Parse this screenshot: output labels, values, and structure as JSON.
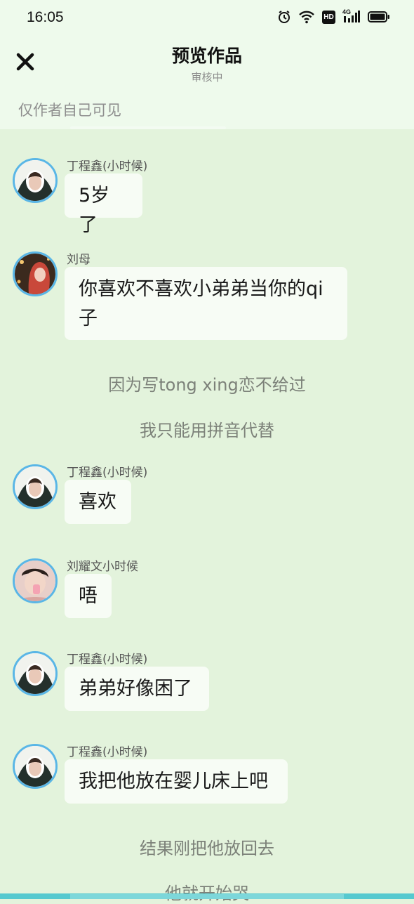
{
  "status_bar": {
    "time": "16:05",
    "hd_label": "HD",
    "network_label": "4G"
  },
  "header": {
    "title": "预览作品",
    "subtitle": "审核中",
    "visibility_note": "仅作者自己可见"
  },
  "messages": [
    {
      "sender": "丁程鑫(小时候)",
      "text": "5岁了"
    },
    {
      "sender": "刘母",
      "line1": "你喜欢不喜欢小弟弟当你的qi",
      "line2": "子"
    },
    {
      "sender": "丁程鑫(小时候)",
      "text": "喜欢"
    },
    {
      "sender": "刘耀文小时候",
      "text": "唔"
    },
    {
      "sender": "丁程鑫(小时候)",
      "text": "弟弟好像困了"
    },
    {
      "sender": "丁程鑫(小时候)",
      "text": "我把他放在婴儿床上吧"
    }
  ],
  "narrations": [
    "因为写tong xing恋不给过",
    "我只能用拼音代替",
    "结果刚把他放回去",
    "他就开始哭"
  ],
  "colors": {
    "background": "#e3f3dc",
    "header_background": "#eefaec",
    "bubble": "#f7fcf5",
    "avatar_ring": "#5ab6e6",
    "bottom_bar": "#56c9cf"
  }
}
